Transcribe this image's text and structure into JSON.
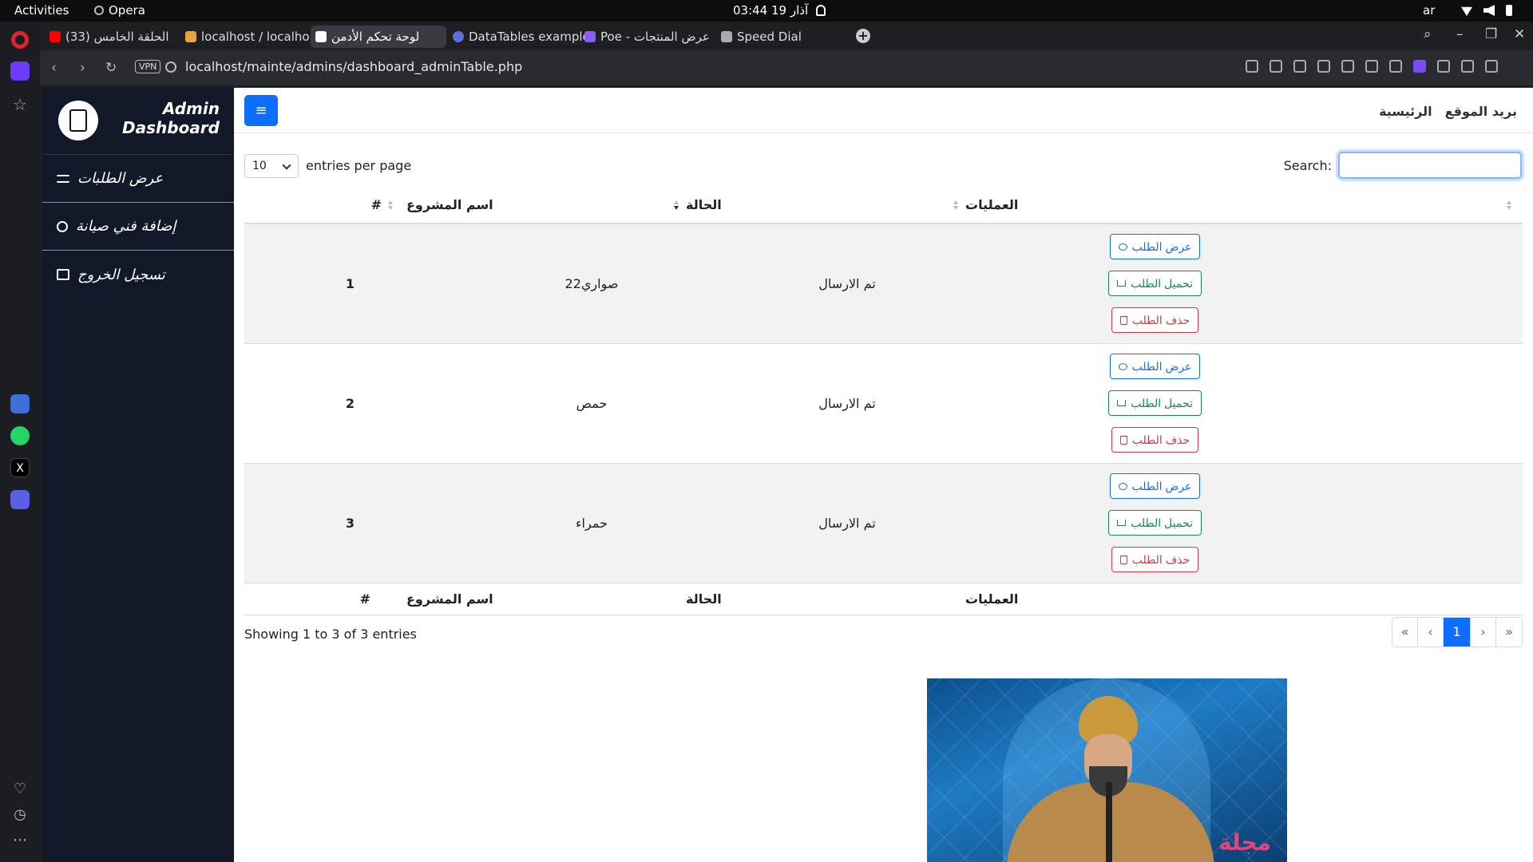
{
  "system": {
    "activities": "Activities",
    "app_name": "Opera",
    "clock": "آذار 19  03:44",
    "input_lang": "ar"
  },
  "tabs": [
    {
      "label": "(33) الحلقة الخامس",
      "favicon_color": "#ff0000"
    },
    {
      "label": "localhost / localhost",
      "favicon_color": "#e8a33c"
    },
    {
      "label": "لوحة تحكم الأدمن",
      "favicon_color": "#ffffff"
    },
    {
      "label": "DataTables example",
      "favicon_color": "#5b6fd8"
    },
    {
      "label": "Poe - عرض المنتجات",
      "favicon_color": "#8b5cf6"
    },
    {
      "label": "Speed Dial",
      "favicon_color": "#aaaaaa"
    }
  ],
  "address": {
    "vpn": "VPN",
    "url": "localhost/mainte/admins/dashboard_adminTable.php"
  },
  "sidebar": {
    "brand": "Admin\nDashboard",
    "items": [
      {
        "label": "عرض الطلبات"
      },
      {
        "label": "إضافة فني صيانة"
      },
      {
        "label": "تسجيل الخروج"
      }
    ]
  },
  "header": {
    "toggle": "≡",
    "nav": [
      "بريد الموقع",
      "الرئيسية"
    ]
  },
  "table_controls": {
    "page_length": "10",
    "length_label": "entries per page",
    "search_label": "Search:",
    "search_value": ""
  },
  "table": {
    "headers": {
      "num": "#",
      "name": "اسم المشروع",
      "status": "الحالة",
      "ops": "العمليات"
    },
    "rows": [
      {
        "num": "1",
        "name": "صواري22",
        "status": "تم الارسال"
      },
      {
        "num": "2",
        "name": "حمص",
        "status": "تم الارسال"
      },
      {
        "num": "3",
        "name": "حمراء",
        "status": "تم الارسال"
      }
    ],
    "buttons": {
      "view": "عرض الطلب",
      "download": "تحميل الطلب",
      "delete": "حذف الطلب"
    }
  },
  "footer_info": "Showing 1 to 3 of 3 entries",
  "pagination": {
    "first": "«",
    "prev": "‹",
    "current": "1",
    "next": "›",
    "last": "»"
  },
  "video": {
    "watermark": "مجلة"
  },
  "colors": {
    "primary": "#0d6efd",
    "success": "#198754",
    "danger": "#dc3545",
    "sidebar_bg": "#111827"
  }
}
